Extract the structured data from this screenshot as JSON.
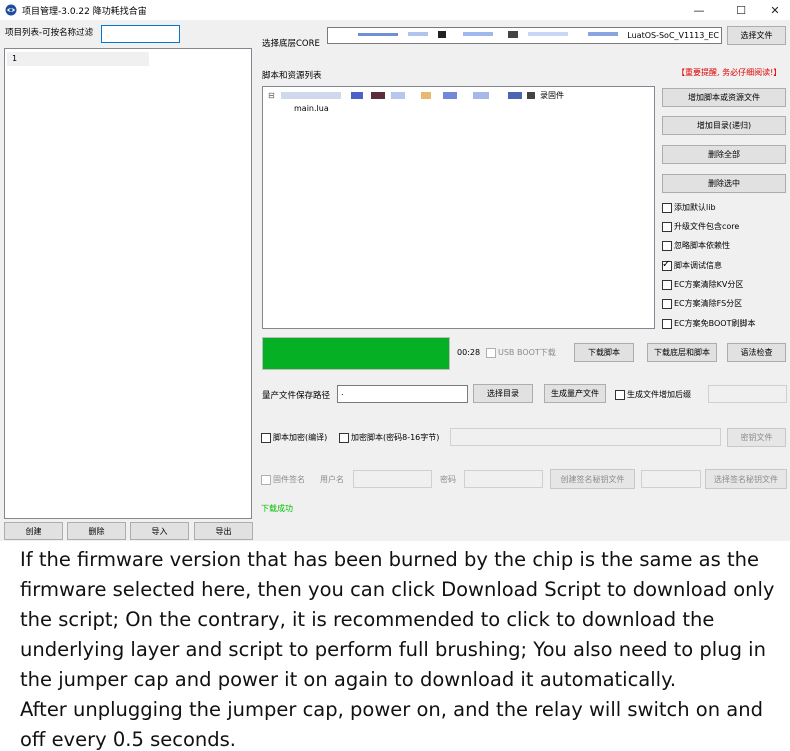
{
  "window": {
    "title": "项目管理-3.0.22 降功耗找合宙",
    "minimize": "—",
    "maximize": "☐",
    "close": "✕"
  },
  "left": {
    "filter_label": "项目列表-可按名称过滤",
    "filter_value": "",
    "projects": [
      "1"
    ],
    "buttons": {
      "create": "创建",
      "delete": "删除",
      "import": "导入",
      "export": "导出"
    }
  },
  "core": {
    "label": "选择底层CORE",
    "value_suffix": "LuatOS-SoC_V1113_EC",
    "select_button": "选择文件"
  },
  "scripts": {
    "label": "脚本和资源列表",
    "warning": "【重要提醒, 务必仔细阅读!】",
    "tree_root_suffix": "录固件",
    "tree_child": "main.lua",
    "buttons": {
      "add_file": "增加脚本或资源文件",
      "add_dir": "增加目录(递归)",
      "delete_all": "删除全部",
      "delete_selected": "删除选中"
    },
    "options": [
      {
        "label": "添加默认lib",
        "checked": false
      },
      {
        "label": "升级文件包含core",
        "checked": false
      },
      {
        "label": "忽略脚本依赖性",
        "checked": false
      },
      {
        "label": "脚本调试信息",
        "checked": true
      },
      {
        "label": "EC方案清除KV分区",
        "checked": false
      },
      {
        "label": "EC方案清除FS分区",
        "checked": false
      },
      {
        "label": "EC方案免BOOT刷脚本",
        "checked": false
      }
    ]
  },
  "download": {
    "progress": 1.0,
    "progress_color": "#06b025",
    "time": "00:28",
    "usb_boot_label": "USB BOOT下载",
    "btn_script": "下载脚本",
    "btn_core_script": "下载底层和脚本",
    "btn_syntax": "语法检查"
  },
  "mass": {
    "label": "量产文件保存路径",
    "path_value": ".",
    "btn_select_dir": "选择目录",
    "btn_generate": "生成量产文件",
    "suffix_label": "生成文件增加后缀"
  },
  "encrypt": {
    "encrypt_compile_label": "脚本加密(编译)",
    "encrypt_script_label": "加密脚本(密码8-16字节)",
    "key_button": "密钥文件"
  },
  "signing": {
    "firmware_sign_label": "固件签名",
    "username_label": "用户名",
    "password_label": "密码",
    "create_key_button": "创建签名秘钥文件",
    "select_key_button": "选择签名秘钥文件"
  },
  "status": {
    "text": "下载成功",
    "color": "#00c000"
  },
  "caption": {
    "paragraph1": "If the firmware version that has been burned by the chip is the same as the firmware selected here, then you can click Download Script to download only the script; On the contrary, it is recommended to click to download the underlying layer and script to perform full brushing; You also need to plug in the jumper cap and power it on again to download it automatically.",
    "paragraph2": "After unplugging the jumper cap, power on, and the relay will switch on and off every 0.5 seconds."
  },
  "colors": {
    "warning": "#e00000",
    "accent": "#0078d7"
  }
}
